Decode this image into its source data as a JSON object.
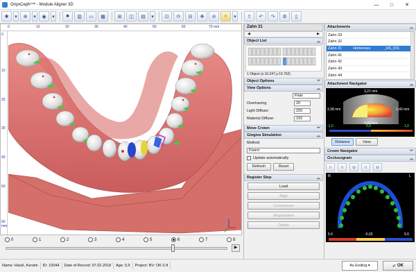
{
  "window": {
    "title": "OnyxCeph³™ - Module Aligner 3D",
    "controls": [
      "—",
      "□",
      "✕"
    ]
  },
  "toolbar": {
    "icons": [
      "gear-icon",
      "dropdown",
      "select-icon",
      "dropdown",
      "view-icon",
      "dropdown",
      "grid-icon",
      "columns-icon",
      "fit-icon",
      "panels-icon",
      "tooth-icon",
      "grid2-icon",
      "dropdown",
      "align-icon",
      "rotate-icon",
      "section-icon",
      "move-icon",
      "split-icon",
      "arch-icon",
      "dropdown",
      "export-icon",
      "undo-icon",
      "redo-icon",
      "settings-icon",
      "document-icon"
    ]
  },
  "ruler": {
    "top": [
      "0",
      "10",
      "20",
      "30",
      "40",
      "50",
      "60",
      "70 mm"
    ],
    "left": [
      "0",
      "10",
      "20",
      "30",
      "40",
      "50",
      "60 mm"
    ]
  },
  "timeline": {
    "steps": [
      "0",
      "1",
      "2",
      "3",
      "4",
      "5",
      "6",
      "7",
      "8"
    ],
    "selected": "6",
    "play": "▶"
  },
  "tooth_panel": {
    "title": "Zahn 31",
    "object_list": {
      "title": "Object List",
      "summary": "1 Object (x:10.247,y:19.762)"
    },
    "object_options": {
      "title": "Object Options"
    },
    "view_options": {
      "title": "View Options",
      "mode": "Flats",
      "overtracing_label": "Overtracing",
      "overtracing_value": "20",
      "light_label": "Light Diffuse:",
      "light_value": "220",
      "material_label": "Material Diffuse:",
      "material_value": "192"
    },
    "move_crown": {
      "title": "Move Crown"
    },
    "gingiva": {
      "title": "Gingiva Simulation",
      "method_label": "Method",
      "method_value": "Fixiert",
      "auto_label": "Update automatically",
      "refresh": "Refresh",
      "reset": "Reset"
    },
    "register": {
      "title": "Register Step",
      "buttons": [
        "Load",
        "Align",
        "Comparison",
        "Registration",
        "Delete"
      ]
    }
  },
  "attachments": {
    "title": "Attachments",
    "rows": [
      {
        "name": "Zahn 33",
        "type": "",
        "id": "",
        "selected": false
      },
      {
        "name": "Zahn 32",
        "type": "",
        "id": "",
        "selected": false
      },
      {
        "name": "Zahn 31",
        "type": "Hohenoes",
        "id": "_HS_031",
        "selected": true
      },
      {
        "name": "Zahn 41",
        "type": "",
        "id": "",
        "selected": false
      },
      {
        "name": "Zahn 42",
        "type": "",
        "id": "",
        "selected": false
      },
      {
        "name": "Zahn 43",
        "type": "",
        "id": "",
        "selected": false
      },
      {
        "name": "Zahn 44",
        "type": "",
        "id": "",
        "selected": false
      }
    ]
  },
  "attachment_navigator": {
    "title": "Attachment Navigator",
    "labels": {
      "top": "3,21 mm",
      "left": "3,38 mm",
      "right": "1,40 mm",
      "bottom": "2,92 mm"
    },
    "scale": [
      "-1,0",
      "0,0",
      "1,0"
    ],
    "tabs": [
      "Distance",
      "View"
    ]
  },
  "crown_navigator": {
    "title": "Crown Navigator"
  },
  "occlusogram": {
    "title": "Occlusogram",
    "side_left": "R",
    "side_right": "L",
    "scale": [
      "5.0",
      "-0,03",
      "5.0"
    ]
  },
  "status": {
    "patient": "Name: Häckl, Kerstin",
    "id": "ID: 10044",
    "date": "Date of Record: 07.02.2018",
    "age": "Age: 9,9",
    "project": "Project: BV: OK 0-8",
    "ending": "As Ending",
    "ok": "OK"
  },
  "colors": {
    "gingiva": "#d86f6f",
    "teeth": "#f2f2f2",
    "contact": "#3ccf3c",
    "selection": "#2f7bd0"
  }
}
